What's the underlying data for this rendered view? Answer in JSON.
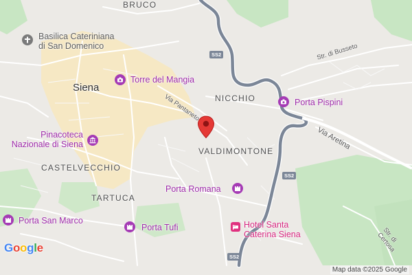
{
  "map": {
    "areas": {
      "bruco": "BRUCO",
      "nicchio": "NICCHIO",
      "valdimontone": "VALDIMONTONE",
      "castelvecchio": "CASTELVECCHIO",
      "tartuca": "TARTUCA"
    },
    "city": "Siena",
    "poi": {
      "basilica_line1": "Basilica Cateriniana",
      "basilica_line2": "di San Domenico",
      "torre": "Torre del Mangia",
      "pinacoteca_line1": "Pinacoteca",
      "pinacoteca_line2": "Nazionale di Siena",
      "porta_pispini": "Porta Pispini",
      "porta_romana": "Porta Romana",
      "porta_san_marco": "Porta San Marco",
      "porta_tufi": "Porta Tufi"
    },
    "hotel": {
      "line1": "Hotel Santa",
      "line2": "Caterina Siena"
    },
    "streets": {
      "via_pantaneto": "Via Pantaneto",
      "via_aretina": "Via Aretina",
      "str_busseto": "Str. di Busseto",
      "str_certosa_line1": "Str. di",
      "str_certosa_line2": "Certosa"
    },
    "road_shields": [
      "SS2",
      "SS2",
      "SS2"
    ],
    "icons": {
      "basilica": "place-of-worship-icon",
      "torre": "camera-icon",
      "pinacoteca": "museum-icon",
      "porta_pispini": "camera-icon",
      "porta_romana": "castle-icon",
      "porta_san_marco": "castle-icon",
      "porta_tufi": "castle-icon",
      "hotel": "bed-icon",
      "pin": "map-pin-icon"
    },
    "colors": {
      "background": "#eceae6",
      "park": "#c8e6c3",
      "historic_center": "#f6e8c4",
      "highway": "#7b8697",
      "poi_purple": "#9d2aa8",
      "hotel_pink": "#d6267f",
      "pin_red": "#e53935"
    }
  },
  "footer": {
    "logo": "Google",
    "attribution": "Map data ©2025 Google"
  }
}
